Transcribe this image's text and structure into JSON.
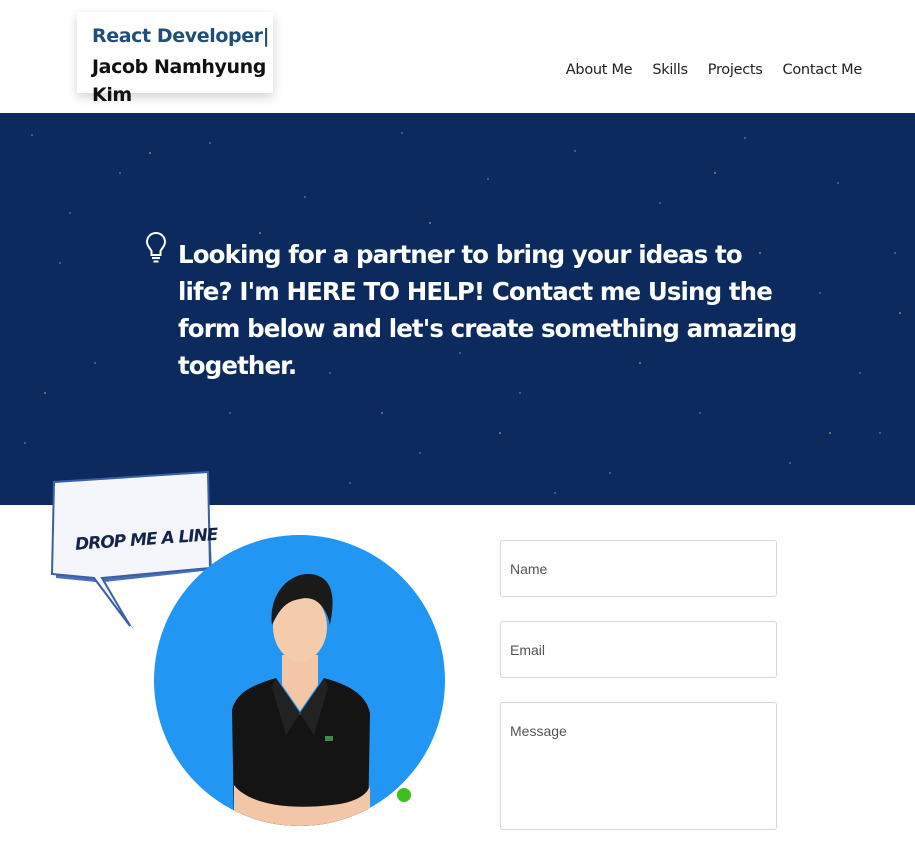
{
  "header": {
    "role": "React Developer|",
    "name": "Jacob Namhyung Kim",
    "nav": [
      {
        "label": "About Me"
      },
      {
        "label": "Skills"
      },
      {
        "label": "Projects"
      },
      {
        "label": "Contact Me"
      }
    ]
  },
  "hero": {
    "icon": "lightbulb-icon",
    "text": "Looking for a partner to bring your ideas to life? I'm HERE TO HELP! Contact me Using the form below and let's create something amazing together.",
    "background_color": "#0d2a5e"
  },
  "contact": {
    "bubble_text": "DROP ME A LINE !",
    "avatar_bg_color": "#2196f3",
    "status_color": "#3cc01a",
    "form": {
      "name_placeholder": "Name",
      "email_placeholder": "Email",
      "message_placeholder": "Message"
    }
  }
}
